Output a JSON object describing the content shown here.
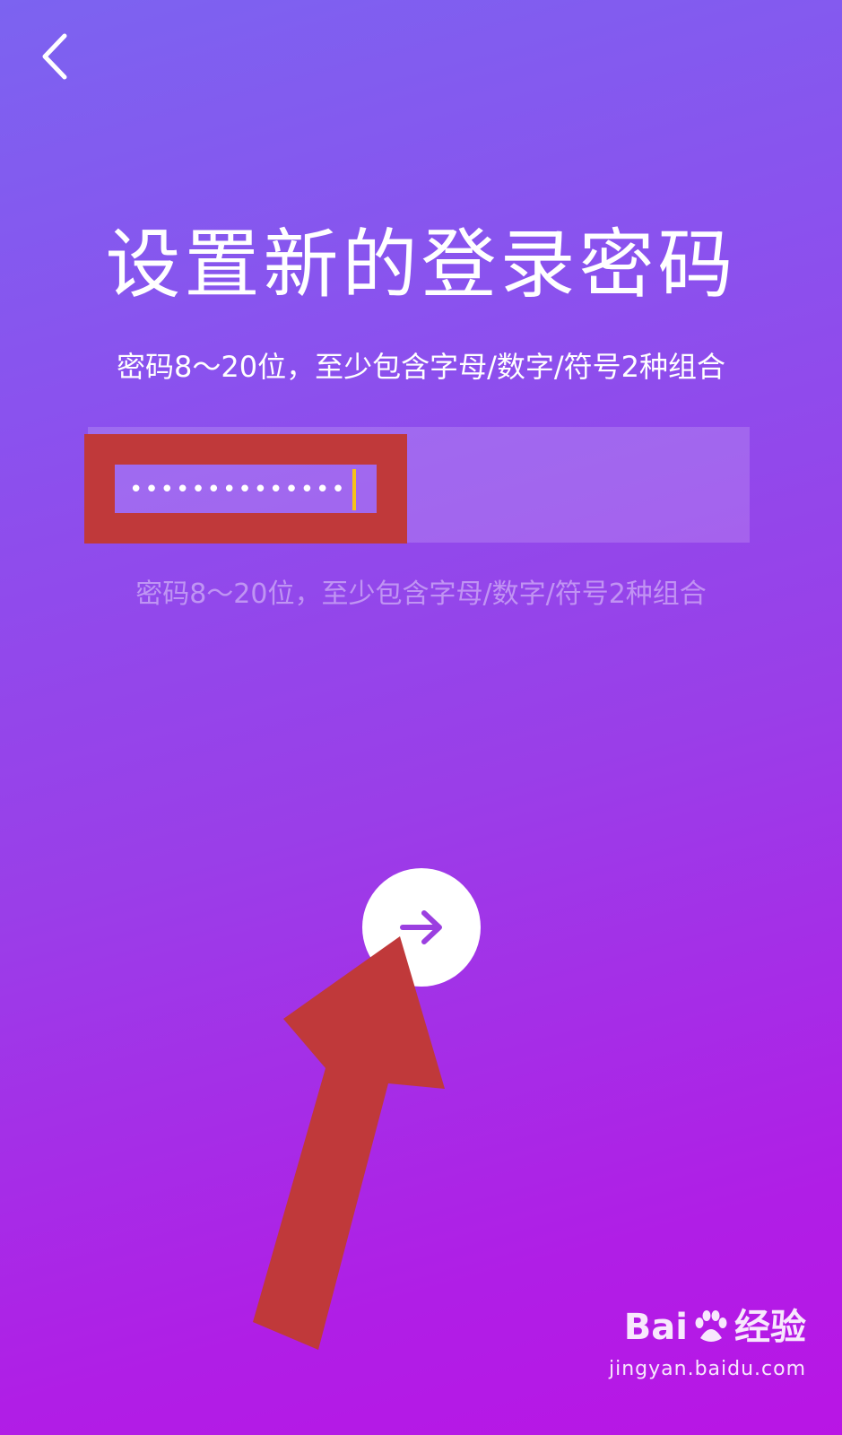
{
  "header": {
    "back_icon": "chevron-left-icon"
  },
  "main": {
    "title": "设置新的登录密码",
    "subtitle": "密码8～20位，至少包含字母/数字/符号2种组合",
    "password_input": {
      "value": "••••••••••••••",
      "type": "password"
    },
    "hint": "密码8～20位，至少包含字母/数字/符号2种组合",
    "next_icon": "arrow-right-icon"
  },
  "colors": {
    "gradient_start": "#7c63f0",
    "gradient_end": "#b915e5",
    "caret": "#f6c21a",
    "annotation_red": "#c0393a",
    "arrow_purple": "#9b3fe0"
  },
  "watermark": {
    "brand_left": "Bai",
    "brand_right": "经验",
    "domain": "jingyan.baidu.com"
  }
}
